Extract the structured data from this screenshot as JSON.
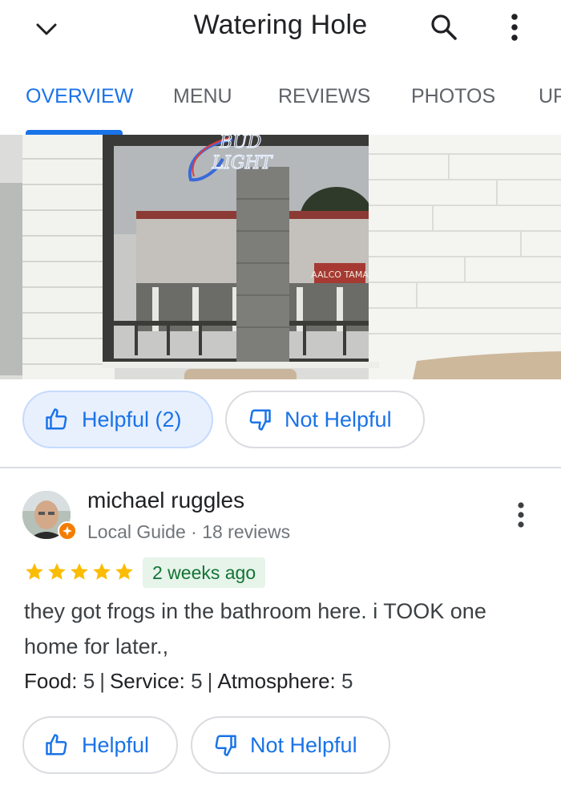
{
  "header": {
    "title": "Watering Hole",
    "back_icon": "chevron-down-icon",
    "search_icon": "search-icon",
    "more_icon": "more-vert-icon"
  },
  "tabs": [
    {
      "label": "OVERVIEW",
      "active": true
    },
    {
      "label": "MENU",
      "active": false
    },
    {
      "label": "REVIEWS",
      "active": false
    },
    {
      "label": "PHOTOS",
      "active": false
    },
    {
      "label": "UP",
      "active": false
    }
  ],
  "photo": {
    "sign_text_1": "BUD",
    "sign_text_2": "LIGHT",
    "storefront_sign": "AALCO TAMA"
  },
  "prev_review_actions": {
    "helpful_label": "Helpful (2)",
    "not_helpful_label": "Not Helpful"
  },
  "review": {
    "reviewer_name": "michael ruggles",
    "reviewer_role": "Local Guide",
    "meta_separator": " · ",
    "reviewer_count": "18 reviews",
    "rating": 5,
    "time_ago": "2 weeks ago",
    "text": "they got frogs in the bathroom here. i TOOK one home for later.,",
    "ratings": [
      {
        "label": "Food:",
        "value": "5"
      },
      {
        "label": "Service:",
        "value": "5"
      },
      {
        "label": "Atmosphere:",
        "value": "5"
      }
    ],
    "helpful_label": "Helpful",
    "not_helpful_label": "Not Helpful"
  },
  "colors": {
    "accent": "#1a73e8",
    "star": "#fbbc04",
    "time_badge_bg": "#e6f4ea",
    "time_badge_fg": "#137333",
    "guide_badge": "#f57c00"
  }
}
